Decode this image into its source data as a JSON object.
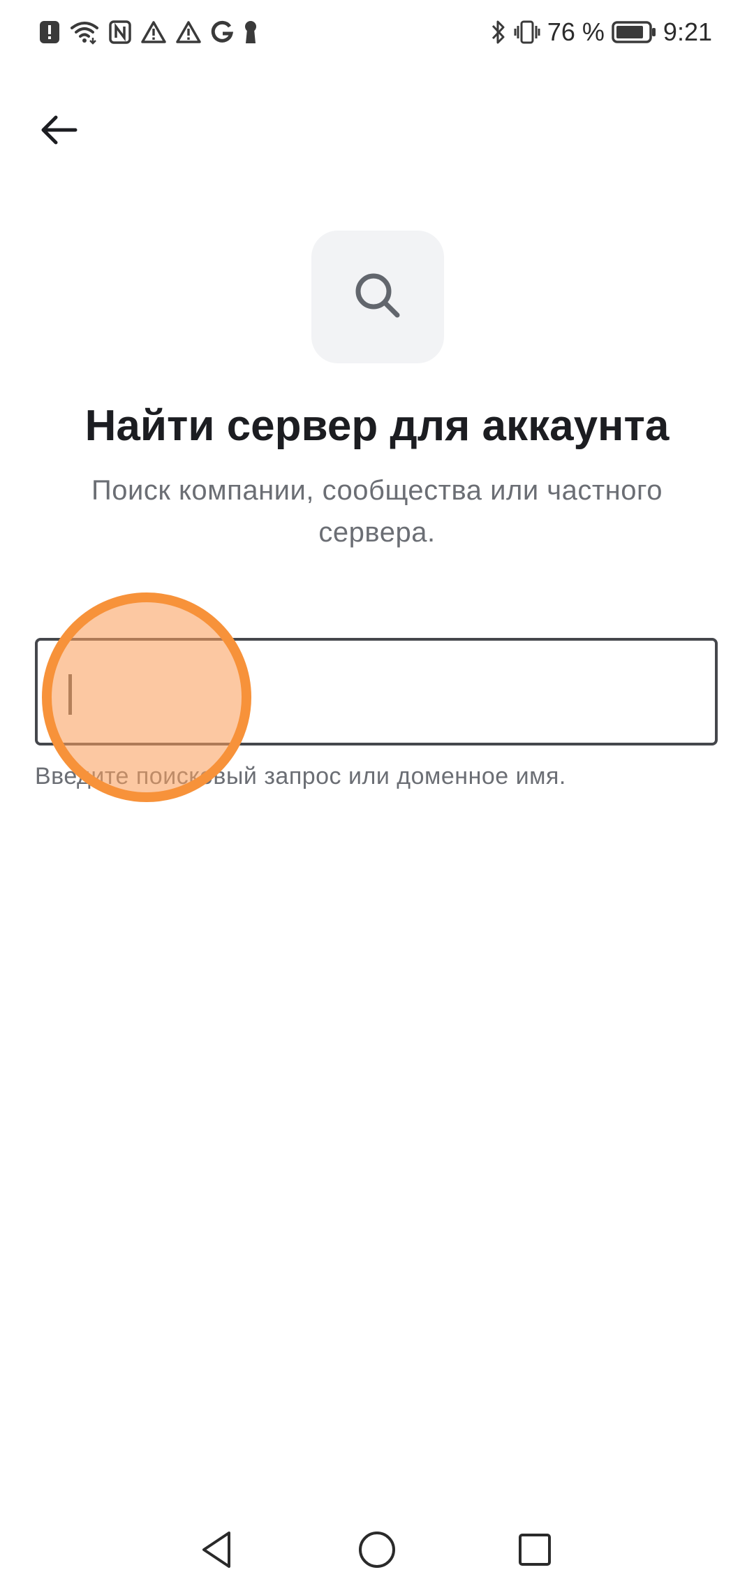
{
  "status_bar": {
    "battery_percent": "76 %",
    "time": "9:21",
    "left_icons": [
      "alert-badge-icon",
      "wifi-icon",
      "nfc-icon",
      "warning-icon",
      "warning-icon",
      "google-icon",
      "keyhole-icon"
    ],
    "right_icons": [
      "bluetooth-icon",
      "vibrate-icon",
      "battery-icon"
    ]
  },
  "header": {
    "back_icon": "arrow-left-icon"
  },
  "hero": {
    "icon": "search-icon"
  },
  "content": {
    "title": "Найти сервер для аккаунта",
    "subtitle": "Поиск компании, сообщества или частного сервера."
  },
  "search": {
    "value": "",
    "placeholder": "",
    "helper": "Введите поисковый запрос или доменное имя."
  },
  "nav_bar": {
    "buttons": [
      "back-triangle-icon",
      "home-circle-icon",
      "recents-square-icon"
    ]
  },
  "colors": {
    "background": "#ffffff",
    "text_primary": "#1c1d21",
    "text_secondary": "#6b6e74",
    "field_border": "#45474c",
    "icon_tile": "#f2f3f5",
    "touch_indicator": "#f7923a"
  }
}
